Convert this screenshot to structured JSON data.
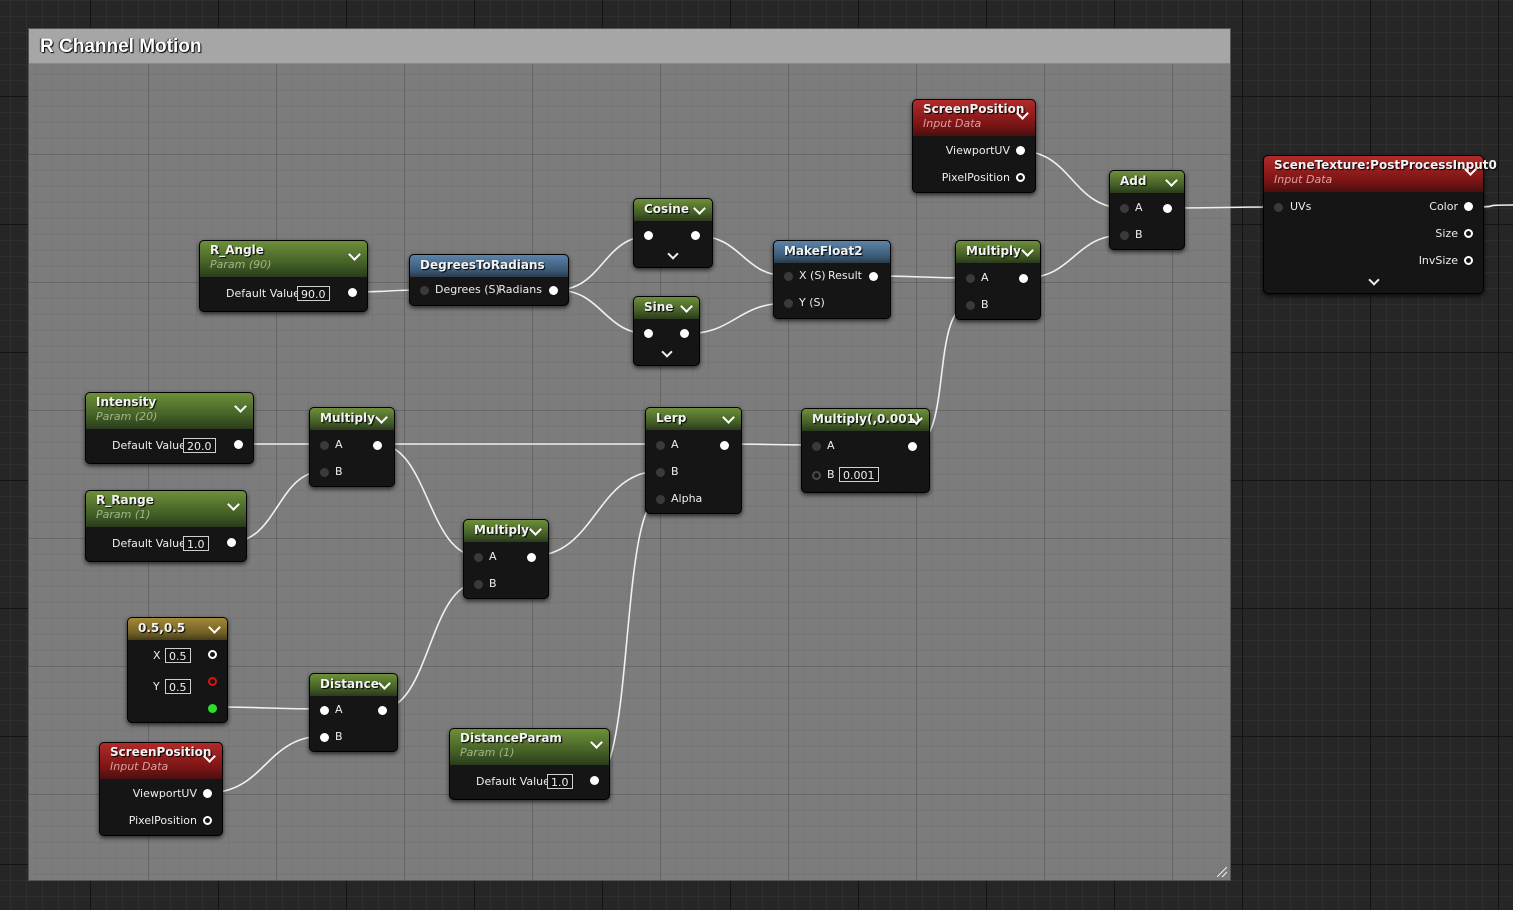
{
  "comment": {
    "title": "R Channel Motion"
  },
  "nodes": {
    "screenpos_top": {
      "title": "ScreenPosition",
      "subtitle": "Input Data",
      "out1": "ViewportUV",
      "out2": "PixelPosition"
    },
    "scenetex": {
      "title": "SceneTexture:PostProcessInput0",
      "subtitle": "Input Data",
      "in1": "UVs",
      "out1": "Color",
      "out2": "Size",
      "out3": "InvSize"
    },
    "add": {
      "title": "Add",
      "in1": "A",
      "in2": "B"
    },
    "cosine": {
      "title": "Cosine"
    },
    "sine": {
      "title": "Sine"
    },
    "makefloat2": {
      "title": "MakeFloat2",
      "in1": "X (S)",
      "in2": "Y (S)",
      "out1": "Result"
    },
    "multiply_top": {
      "title": "Multiply",
      "in1": "A",
      "in2": "B"
    },
    "r_angle": {
      "title": "R_Angle",
      "subtitle": "Param (90)",
      "label": "Default Value",
      "value": "90.0"
    },
    "deg2rad": {
      "title": "DegreesToRadians",
      "in1": "Degrees (S)",
      "out1": "Radians"
    },
    "intensity": {
      "title": "Intensity",
      "subtitle": "Param (20)",
      "label": "Default Value",
      "value": "20.0"
    },
    "multiply_mid": {
      "title": "Multiply",
      "in1": "A",
      "in2": "B"
    },
    "lerp": {
      "title": "Lerp",
      "in1": "A",
      "in2": "B",
      "in3": "Alpha"
    },
    "multiply_const": {
      "title": "Multiply(,0.001)",
      "in1": "A",
      "in2": "B",
      "value": "0.001"
    },
    "r_range": {
      "title": "R_Range",
      "subtitle": "Param (1)",
      "label": "Default Value",
      "value": "1.0"
    },
    "multiply_low": {
      "title": "Multiply",
      "in1": "A",
      "in2": "B"
    },
    "const2": {
      "title": "0.5,0.5",
      "x_label": "X",
      "x_value": "0.5",
      "y_label": "Y",
      "y_value": "0.5"
    },
    "distance": {
      "title": "Distance",
      "in1": "A",
      "in2": "B"
    },
    "distanceparam": {
      "title": "DistanceParam",
      "subtitle": "Param (1)",
      "label": "Default Value",
      "value": "1.0"
    },
    "screenpos_bot": {
      "title": "ScreenPosition",
      "subtitle": "Input Data",
      "out1": "ViewportUV",
      "out2": "PixelPosition"
    }
  }
}
